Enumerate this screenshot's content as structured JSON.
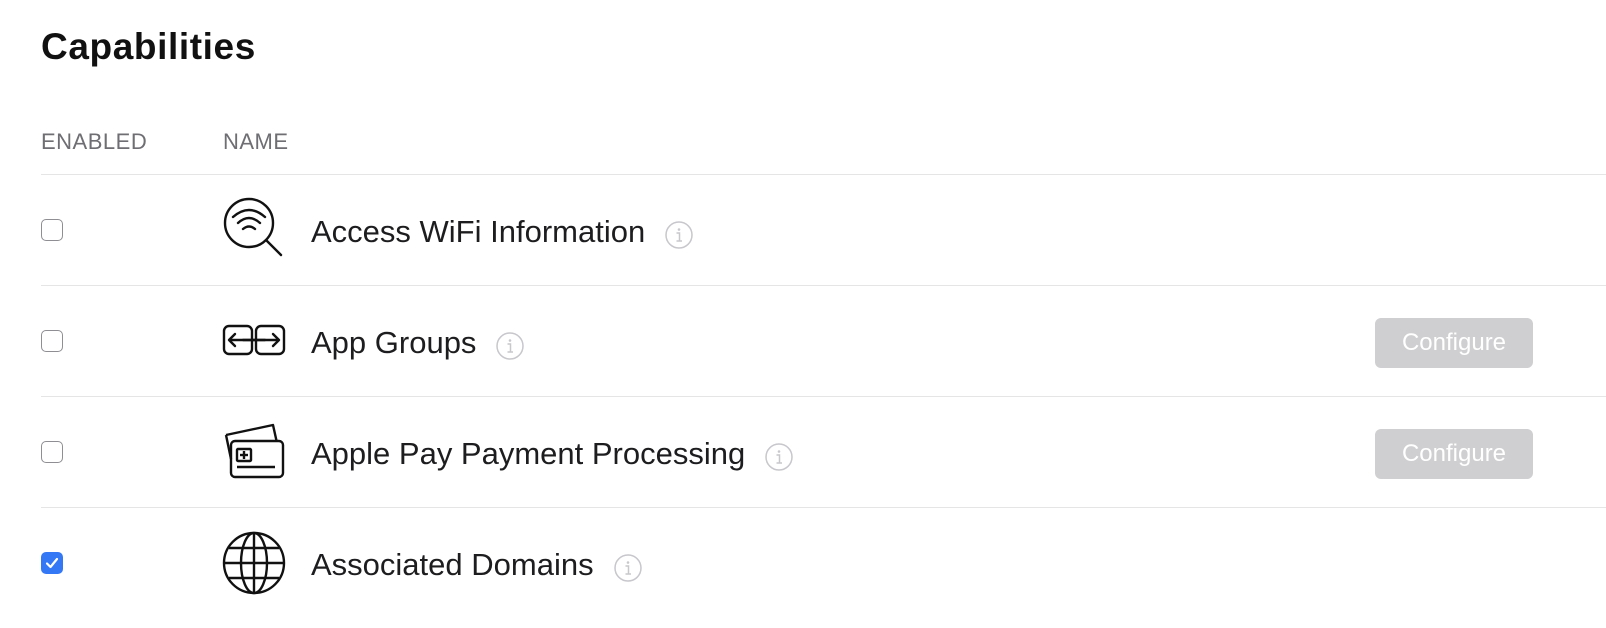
{
  "page": {
    "title": "Capabilities"
  },
  "table": {
    "headers": {
      "enabled": "ENABLED",
      "name": "NAME"
    },
    "rows": [
      {
        "name": "Access WiFi Information",
        "enabled": false,
        "icon": "wifi-search-icon",
        "configure_label": ""
      },
      {
        "name": "App Groups",
        "enabled": false,
        "icon": "app-groups-icon",
        "configure_label": "Configure"
      },
      {
        "name": "Apple Pay Payment Processing",
        "enabled": false,
        "icon": "payment-cards-icon",
        "configure_label": "Configure"
      },
      {
        "name": "Associated Domains",
        "enabled": true,
        "icon": "globe-icon",
        "configure_label": ""
      }
    ]
  },
  "colors": {
    "checkbox_checked": "#3478f6",
    "button_disabled_bg": "#cfcfd1",
    "header_text": "#6e6e73",
    "divider": "#e5e5e5"
  }
}
